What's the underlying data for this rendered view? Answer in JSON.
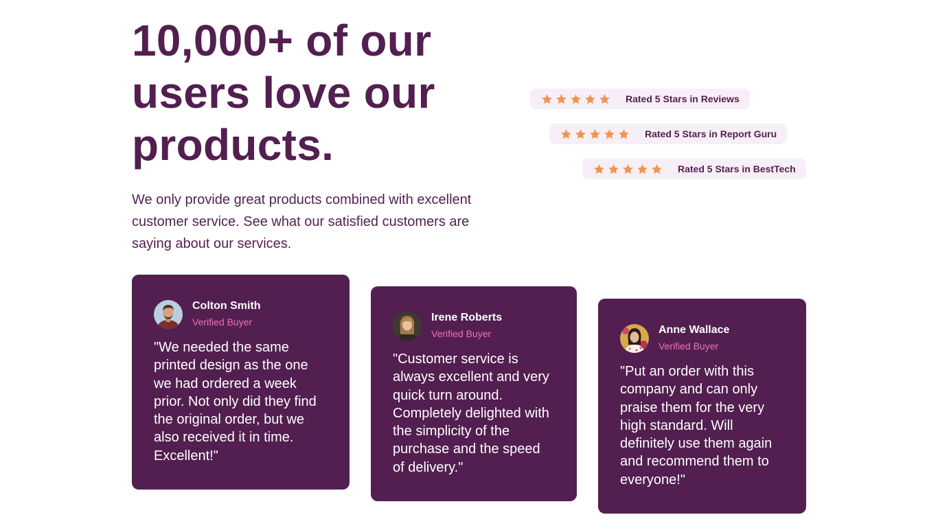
{
  "hero": {
    "headline": "10,000+ of our users love our products.",
    "intro": "We only provide great products combined with excellent customer service. See what our satisfied customers are saying about our services."
  },
  "ratings": [
    {
      "stars": 5,
      "label": "Rated 5 Stars in Reviews"
    },
    {
      "stars": 5,
      "label": "Rated 5 Stars in Report Guru"
    },
    {
      "stars": 5,
      "label": "Rated 5 Stars in BestTech"
    }
  ],
  "testimonials": [
    {
      "name": "Colton Smith",
      "badge": "Verified Buyer",
      "quote": "\"We needed the same printed design as the one we had ordered a week prior. Not only did they find the original order, but we also received it in time. Excellent!\""
    },
    {
      "name": "Irene Roberts",
      "badge": "Verified Buyer",
      "quote": "\"Customer service is always excellent and very quick turn around. Completely delighted with the simplicity of the purchase and the speed of delivery.\""
    },
    {
      "name": "Anne Wallace",
      "badge": "Verified Buyer",
      "quote": "\"Put an order with this company and can only praise them for the very high standard. Will definitely use them again and recommend them to everyone!\""
    }
  ],
  "colors": {
    "primary": "#521f50",
    "star": "#ee9550",
    "accent": "#f172b4",
    "rating_bg": "#f7eff7"
  },
  "icons": {
    "star": "star-icon"
  }
}
